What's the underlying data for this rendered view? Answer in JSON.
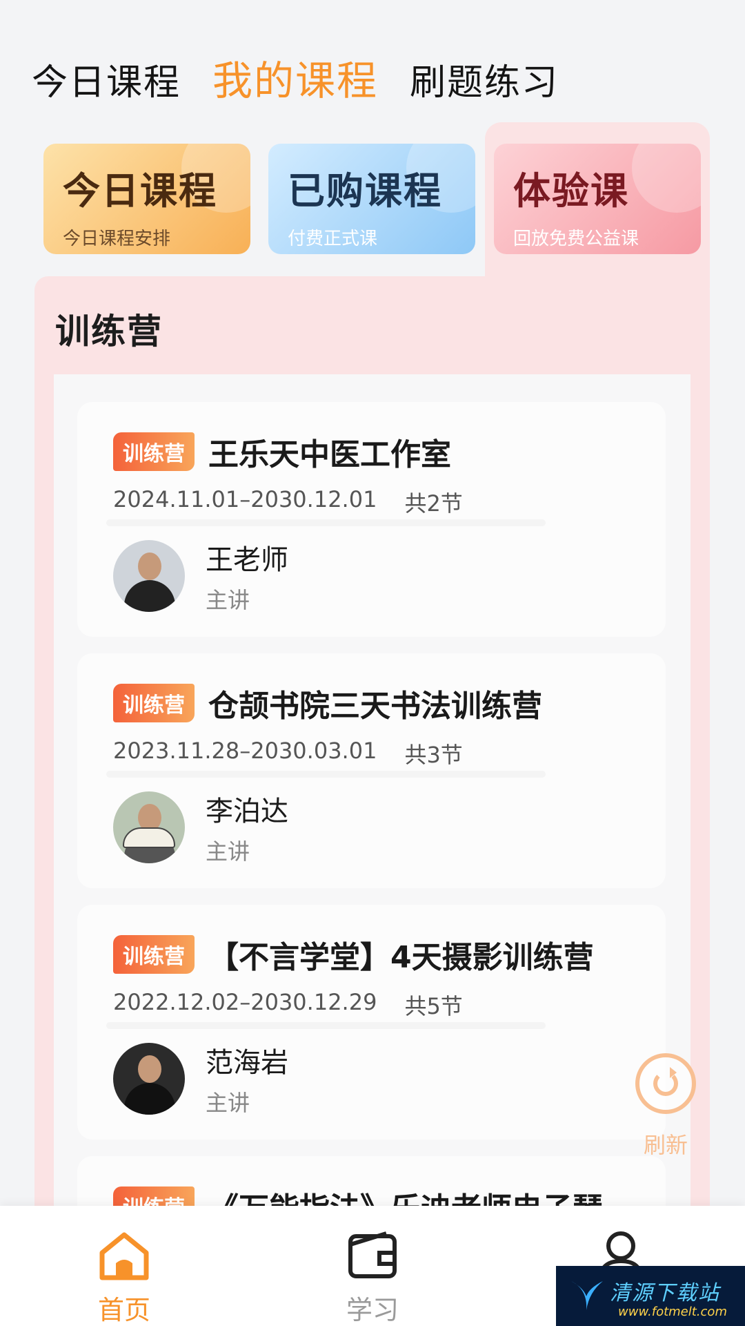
{
  "top_tabs": {
    "today": "今日课程",
    "mine": "我的课程",
    "practice": "刷题练习"
  },
  "categories": [
    {
      "title": "今日课程",
      "subtitle": "今日课程安排"
    },
    {
      "title": "已购课程",
      "subtitle": "付费正式课"
    },
    {
      "title": "体验课",
      "subtitle": "回放免费公益课"
    }
  ],
  "panel": {
    "title": "训练营"
  },
  "courses": [
    {
      "badge": "训练营",
      "title": "王乐天中医工作室",
      "date_range": "2024.11.01–2030.12.01",
      "lessons": "共2节",
      "teacher_name": "王老师",
      "teacher_role": "主讲"
    },
    {
      "badge": "训练营",
      "title": "仓颉书院三天书法训练营",
      "date_range": "2023.11.28–2030.03.01",
      "lessons": "共3节",
      "teacher_name": "李泊达",
      "teacher_role": "主讲"
    },
    {
      "badge": "训练营",
      "title": "【不言学堂】4天摄影训练营",
      "date_range": "2022.12.02–2030.12.29",
      "lessons": "共5节",
      "teacher_name": "范海岩",
      "teacher_role": "主讲"
    },
    {
      "badge": "训练营",
      "title": "《万能指法》乐迪老师电子琴"
    }
  ],
  "refresh": {
    "label": "刷新",
    "icon": "refresh-icon"
  },
  "bottom_nav": {
    "home": {
      "label": "首页",
      "icon": "home-icon"
    },
    "study": {
      "label": "学习",
      "icon": "wallet-icon"
    },
    "me": {
      "label": "",
      "icon": "user-icon"
    }
  },
  "watermark": {
    "text": "清源下载站",
    "url": "www.fotmelt.com"
  },
  "colors": {
    "accent": "#f7922a",
    "panel_bg": "#fbe3e4",
    "badge_start": "#f4623a",
    "badge_end": "#f8a55a"
  }
}
